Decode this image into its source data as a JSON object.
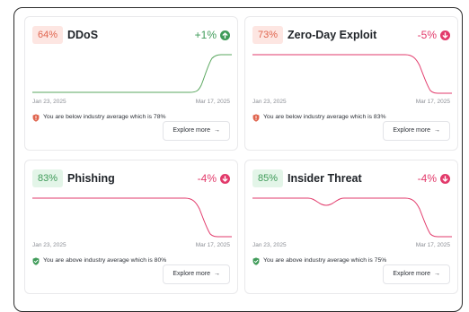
{
  "colors": {
    "score_red_bg": "#fde6e2",
    "score_red_text": "#e0654f",
    "score_green_bg": "#e3f5e8",
    "score_green_text": "#3f9b59",
    "trend_up": "#3f9b59",
    "trend_down": "#e23a6b",
    "spark_up": "#5aa75f",
    "spark_down": "#e23a6b"
  },
  "explore_label": "Explore more",
  "cards": [
    {
      "score": "64%",
      "score_tone": "red",
      "title": "DDoS",
      "change": "+1%",
      "direction": "up",
      "date_start": "Jan 23, 2025",
      "date_end": "Mar 17, 2025",
      "status_text": "You are below industry average which is 78%",
      "status_icon": "shield-warning-icon",
      "status_tone": "red"
    },
    {
      "score": "73%",
      "score_tone": "red",
      "title": "Zero-Day Exploit",
      "change": "-5%",
      "direction": "down",
      "date_start": "Jan 23, 2025",
      "date_end": "Mar 17, 2025",
      "status_text": "You are below industry average which is 83%",
      "status_icon": "shield-warning-icon",
      "status_tone": "red"
    },
    {
      "score": "83%",
      "score_tone": "green",
      "title": "Phishing",
      "change": "-4%",
      "direction": "down",
      "date_start": "Jan 23, 2025",
      "date_end": "Mar 17, 2025",
      "status_text": "You are above industry average which is 80%",
      "status_icon": "shield-check-icon",
      "status_tone": "green"
    },
    {
      "score": "85%",
      "score_tone": "green",
      "title": "Insider Threat",
      "change": "-4%",
      "direction": "down",
      "date_start": "Jan 23, 2025",
      "date_end": "Mar 17, 2025",
      "status_text": "You are above industry average which is 75%",
      "status_icon": "shield-check-icon",
      "status_tone": "green"
    }
  ]
}
